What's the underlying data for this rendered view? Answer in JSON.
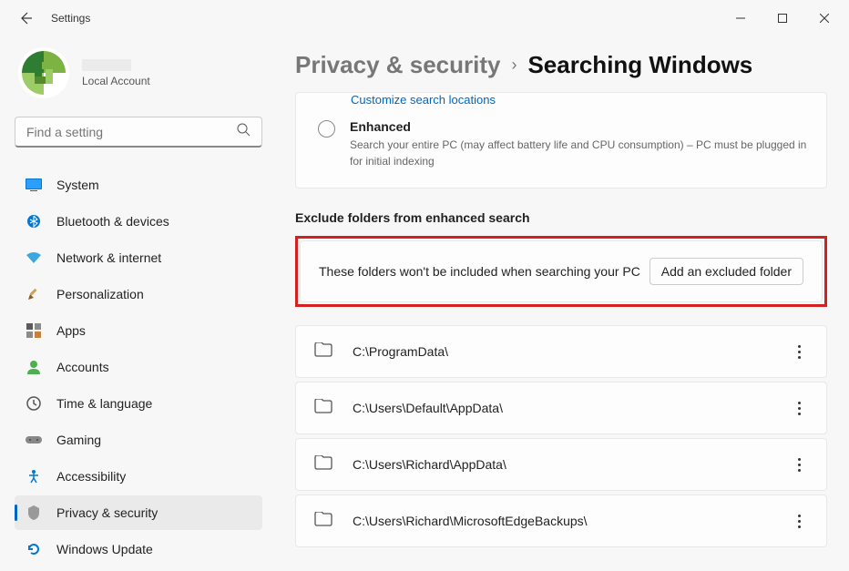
{
  "window": {
    "title": "Settings"
  },
  "profile": {
    "account_type": "Local Account"
  },
  "search": {
    "placeholder": "Find a setting"
  },
  "nav": {
    "items": [
      {
        "label": "System",
        "icon": "system"
      },
      {
        "label": "Bluetooth & devices",
        "icon": "bluetooth"
      },
      {
        "label": "Network & internet",
        "icon": "network"
      },
      {
        "label": "Personalization",
        "icon": "personalization"
      },
      {
        "label": "Apps",
        "icon": "apps"
      },
      {
        "label": "Accounts",
        "icon": "accounts"
      },
      {
        "label": "Time & language",
        "icon": "time"
      },
      {
        "label": "Gaming",
        "icon": "gaming"
      },
      {
        "label": "Accessibility",
        "icon": "accessibility"
      },
      {
        "label": "Privacy & security",
        "icon": "privacy"
      },
      {
        "label": "Windows Update",
        "icon": "update"
      }
    ]
  },
  "breadcrumb": {
    "parent": "Privacy & security",
    "current": "Searching Windows"
  },
  "topcard": {
    "customize": "Customize search locations",
    "enhanced_title": "Enhanced",
    "enhanced_desc": "Search your entire PC (may affect battery life and CPU consumption) – PC must be plugged in for initial indexing"
  },
  "exclude": {
    "header": "Exclude folders from enhanced search",
    "desc": "These folders won't be included when searching your PC",
    "add_btn": "Add an excluded folder",
    "folders": [
      "C:\\ProgramData\\",
      "C:\\Users\\Default\\AppData\\",
      "C:\\Users\\Richard\\AppData\\",
      "C:\\Users\\Richard\\MicrosoftEdgeBackups\\"
    ]
  }
}
